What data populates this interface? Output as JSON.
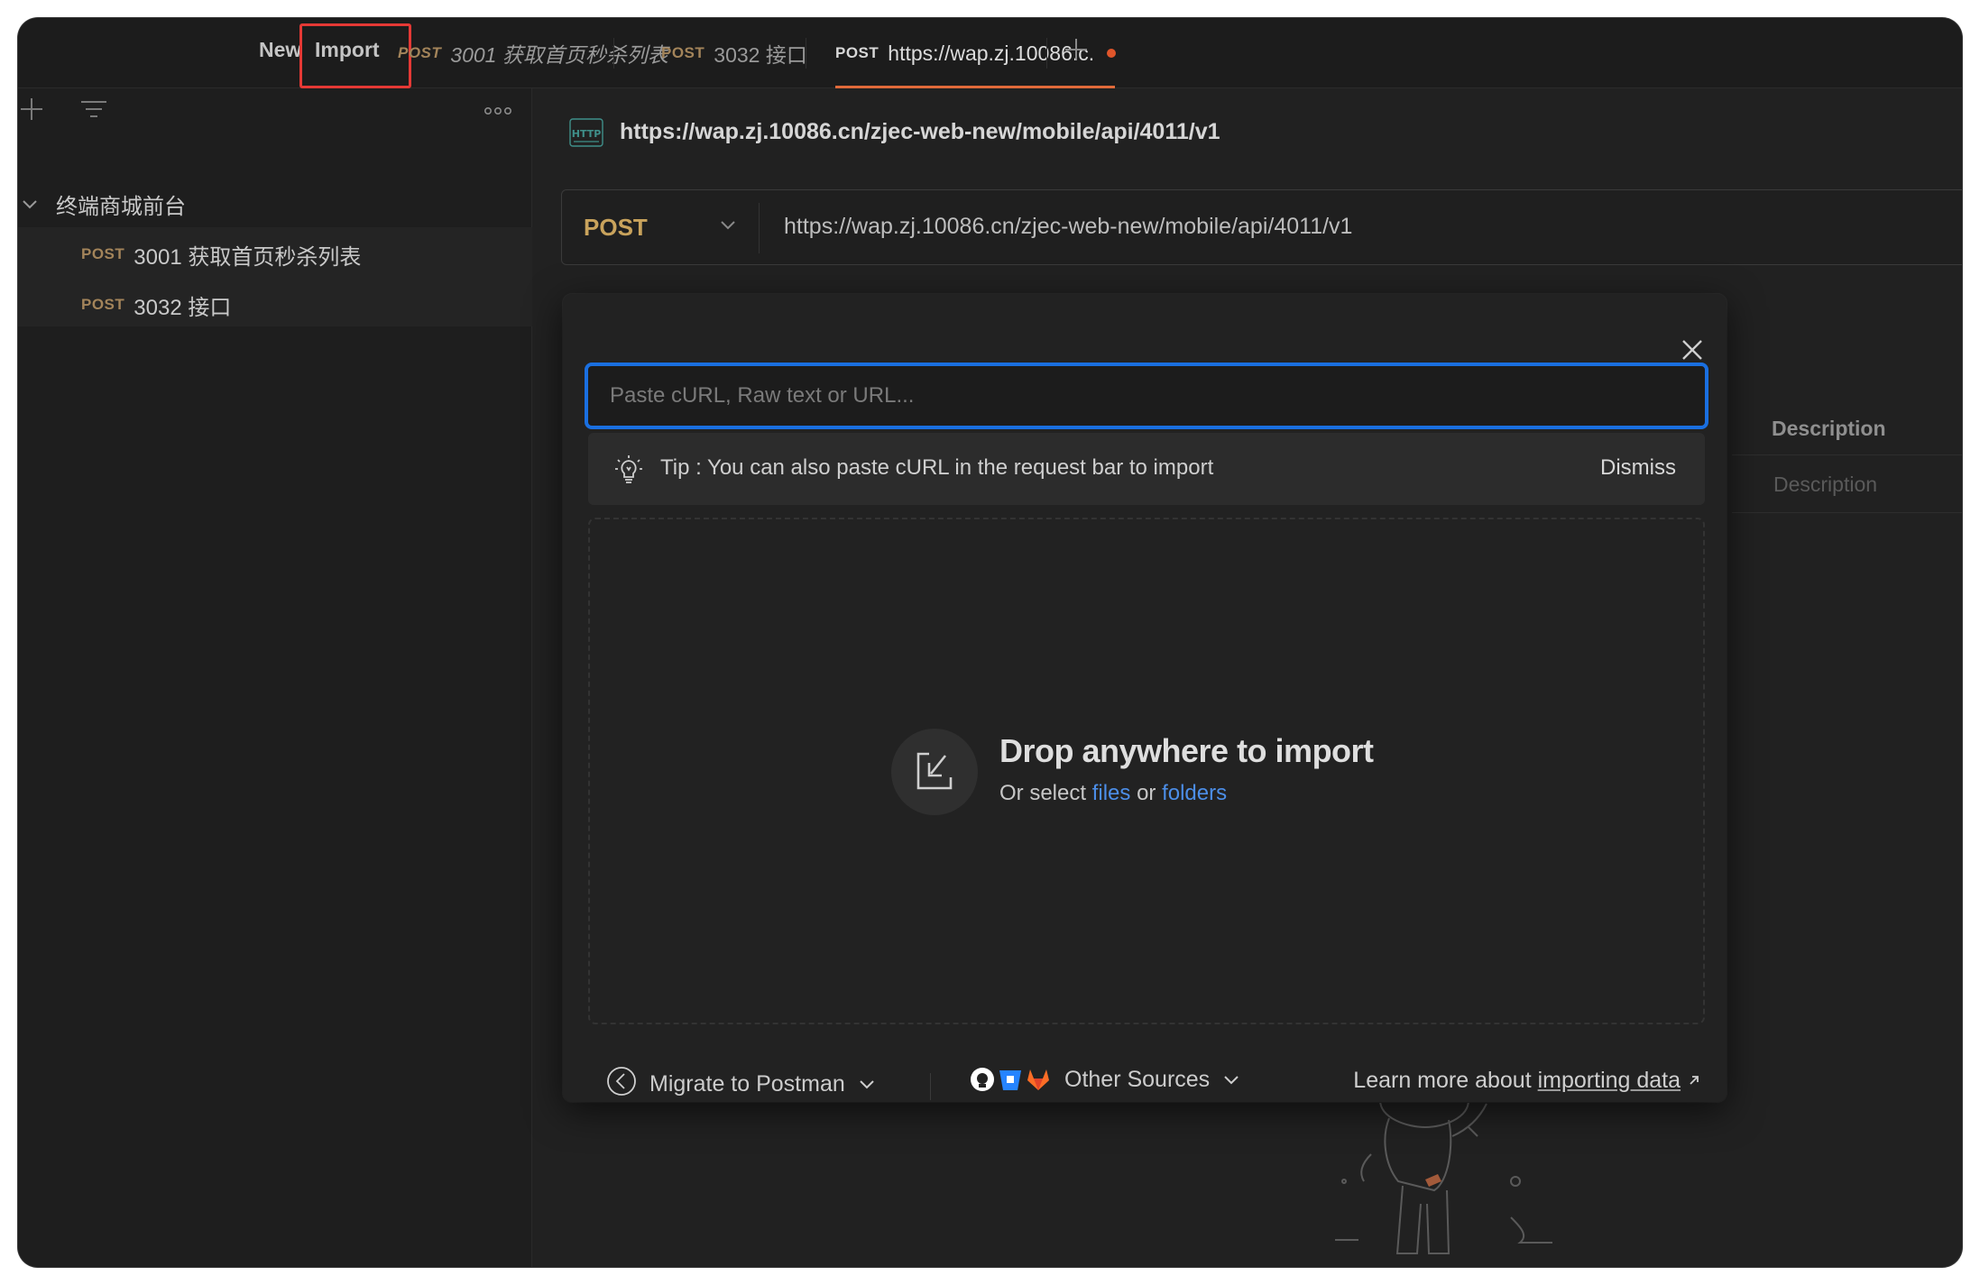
{
  "topbar": {
    "new_label": "New",
    "import_label": "Import",
    "tabs": [
      {
        "method": "POST",
        "title": "3001 获取首页秒杀列表"
      },
      {
        "method": "POST",
        "title": "3032 接口"
      },
      {
        "method": "POST",
        "title": "https://wap.zj.10086.c."
      }
    ]
  },
  "sidebar": {
    "collection": "终端商城前台",
    "requests": [
      {
        "method": "POST",
        "name": "3001 获取首页秒杀列表"
      },
      {
        "method": "POST",
        "name": "3032 接口"
      }
    ]
  },
  "request": {
    "title": "https://wap.zj.10086.cn/zjec-web-new/mobile/api/4011/v1",
    "method": "POST",
    "url": "https://wap.zj.10086.cn/zjec-web-new/mobile/api/4011/v1"
  },
  "background_table": {
    "header": "Description",
    "placeholder": "Description"
  },
  "import_modal": {
    "input_placeholder": "Paste cURL, Raw text or URL...",
    "tip": "Tip : You can also paste cURL in the request bar to import",
    "dismiss": "Dismiss",
    "drop_title": "Drop anywhere to import",
    "drop_prefix": "Or select",
    "files_link": "files",
    "or_text": "or",
    "folders_link": "folders",
    "migrate": "Migrate to Postman",
    "other_sources": "Other Sources",
    "learn_prefix": "Learn more about",
    "learn_link": "importing data"
  },
  "colors": {
    "accent_blue": "#1a6fe0",
    "link_blue": "#4c8ee8",
    "method_orange": "#a3845a",
    "tab_underline": "#e06a3a",
    "highlight_red": "#e53935"
  }
}
